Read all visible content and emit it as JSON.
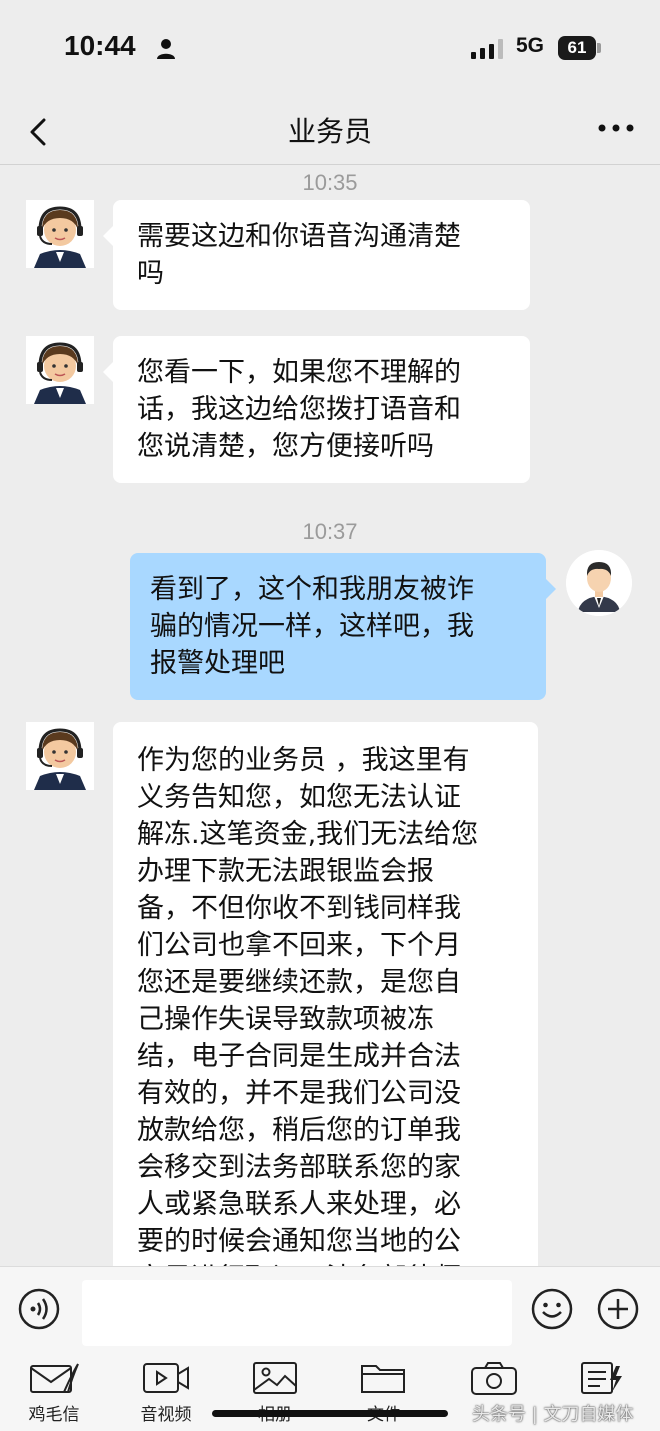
{
  "status_bar": {
    "time": "10:44",
    "network": "5G",
    "battery": "61"
  },
  "header": {
    "title": "业务员"
  },
  "timestamps": [
    "10:35",
    "10:37"
  ],
  "messages": [
    {
      "sender": "agent",
      "text": "需要这边和你语音沟通清楚\n吗"
    },
    {
      "sender": "agent",
      "text": "您看一下，如果您不理解的\n话，我这边给您拨打语音和\n您说清楚，您方便接听吗"
    },
    {
      "sender": "me",
      "text": "看到了，这个和我朋友被诈\n骗的情况一样，这样吧，我\n报警处理吧"
    },
    {
      "sender": "agent",
      "text": "作为您的业务员 ，我这里有\n义务告知您，如您无法认证\n解冻.这笔资金,我们无法给您\n办理下款无法跟银监会报\n备，不但你收不到钱同样我\n们公司也拿不回来，下个月\n您还是要继续还款，是您自\n己操作失误导致款项被冻\n结，电子合同是生成并合法\n有效的，并不是我们公司没\n放款给您，稍后您的订单我\n会移交到法务部联系您的家\n人或紧急联系人来处理，必\n要的时候会通知您当地的公\n安局进行取证，法务部律师"
    }
  ],
  "toolbar": {
    "items": [
      "鸡毛信",
      "音视频",
      "相册",
      "文件",
      "",
      ""
    ]
  },
  "watermark": "头条号 | 文刀自媒体"
}
